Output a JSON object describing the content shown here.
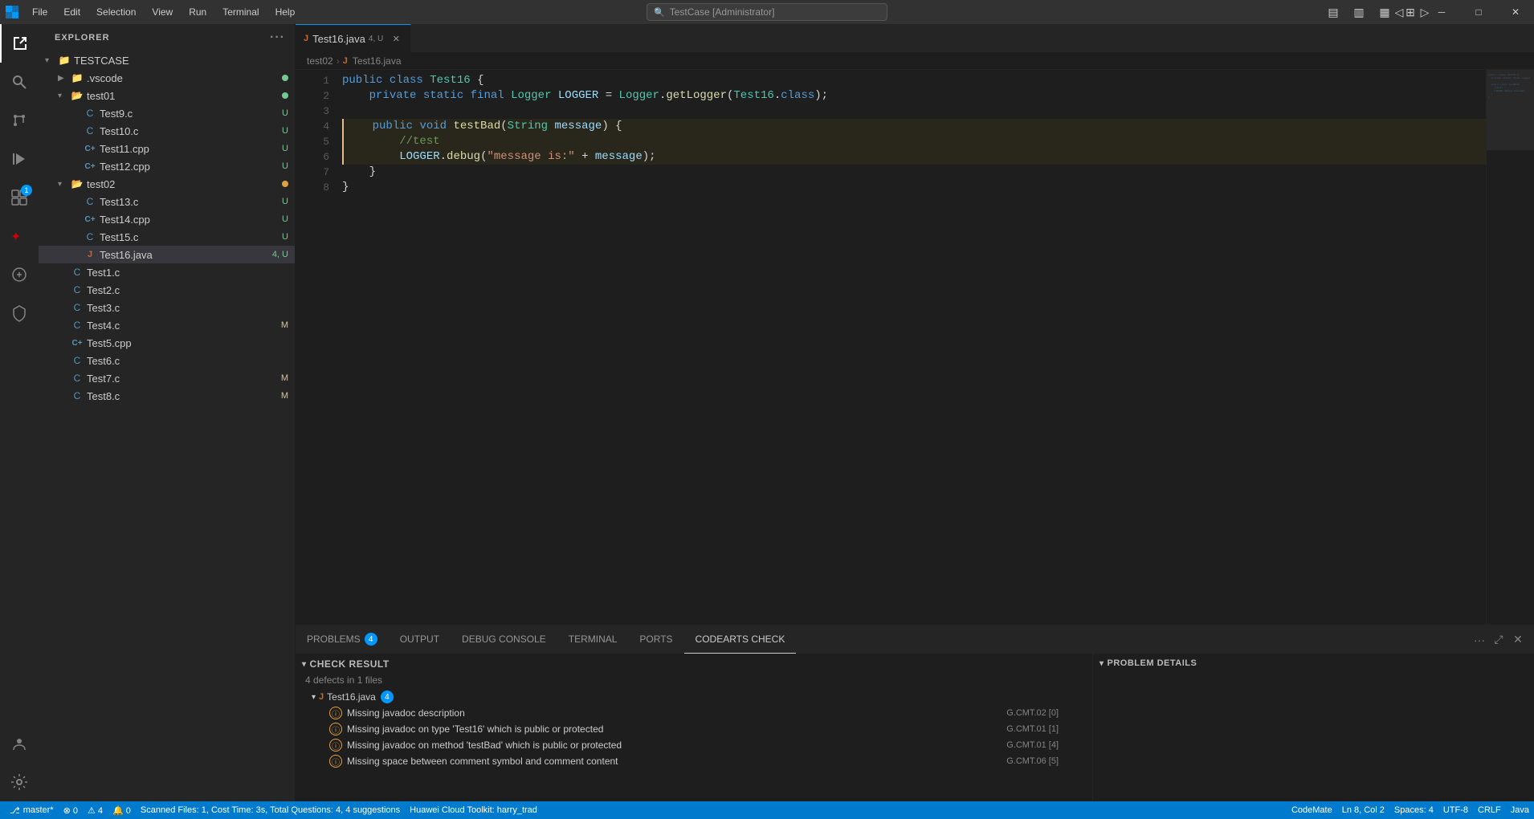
{
  "titlebar": {
    "logo": "◈",
    "menu": [
      "File",
      "Edit",
      "Selection",
      "View",
      "Run",
      "Terminal",
      "Help"
    ],
    "search_placeholder": "TestCase [Administrator]",
    "nav_back": "←",
    "nav_forward": "→",
    "btn_minimize": "─",
    "btn_maximize": "□",
    "btn_restore": "❐",
    "btn_close": "✕"
  },
  "activity_bar": {
    "icons": [
      {
        "name": "explorer-icon",
        "symbol": "⎘",
        "active": true,
        "badge": null
      },
      {
        "name": "search-icon",
        "symbol": "🔍",
        "active": false,
        "badge": null
      },
      {
        "name": "source-control-icon",
        "symbol": "⑂",
        "active": false,
        "badge": null
      },
      {
        "name": "run-debug-icon",
        "symbol": "▶",
        "active": false,
        "badge": null
      },
      {
        "name": "extensions-icon",
        "symbol": "⊞",
        "active": false,
        "badge": "1"
      },
      {
        "name": "huawei-icon",
        "symbol": "✦",
        "active": false,
        "badge": null
      },
      {
        "name": "codearts-icon",
        "symbol": "⊕",
        "active": false,
        "badge": null
      },
      {
        "name": "security-icon",
        "symbol": "🛡",
        "active": false,
        "badge": null
      }
    ],
    "bottom_icons": [
      {
        "name": "accounts-icon",
        "symbol": "👤"
      },
      {
        "name": "settings-icon",
        "symbol": "⚙"
      }
    ]
  },
  "sidebar": {
    "title": "EXPLORER",
    "root_folder": "TESTCASE",
    "items": [
      {
        "indent": 1,
        "type": "folder",
        "name": ".vscode",
        "open": false,
        "badge": "dot-green"
      },
      {
        "indent": 1,
        "type": "folder",
        "name": "test01",
        "open": true,
        "badge": "dot-green"
      },
      {
        "indent": 2,
        "type": "c",
        "name": "Test9.c",
        "badge": "U"
      },
      {
        "indent": 2,
        "type": "c",
        "name": "Test10.c",
        "badge": "U"
      },
      {
        "indent": 2,
        "type": "cpp",
        "name": "Test11.cpp",
        "badge": "U"
      },
      {
        "indent": 2,
        "type": "cpp",
        "name": "Test12.cpp",
        "badge": "U"
      },
      {
        "indent": 1,
        "type": "folder",
        "name": "test02",
        "open": true,
        "badge": "dot-orange"
      },
      {
        "indent": 2,
        "type": "c",
        "name": "Test13.c",
        "badge": "U"
      },
      {
        "indent": 2,
        "type": "cpp",
        "name": "Test14.cpp",
        "badge": "U"
      },
      {
        "indent": 2,
        "type": "c",
        "name": "Test15.c",
        "badge": "U"
      },
      {
        "indent": 2,
        "type": "java",
        "name": "Test16.java",
        "badge": "4,U",
        "active": true
      },
      {
        "indent": 1,
        "type": "c",
        "name": "Test1.c",
        "badge": ""
      },
      {
        "indent": 1,
        "type": "c",
        "name": "Test2.c",
        "badge": ""
      },
      {
        "indent": 1,
        "type": "c",
        "name": "Test3.c",
        "badge": ""
      },
      {
        "indent": 1,
        "type": "c",
        "name": "Test4.c",
        "badge": ""
      },
      {
        "indent": 1,
        "type": "cpp",
        "name": "Test5.cpp",
        "badge": ""
      },
      {
        "indent": 1,
        "type": "c",
        "name": "Test6.c",
        "badge": ""
      },
      {
        "indent": 1,
        "type": "c",
        "name": "Test7.c",
        "badge": "M"
      },
      {
        "indent": 1,
        "type": "c",
        "name": "Test8.c",
        "badge": "M"
      }
    ]
  },
  "tabs": [
    {
      "name": "Test16.java",
      "icon": "java",
      "modified": true,
      "active": true,
      "badge": "4,U"
    }
  ],
  "breadcrumb": {
    "parts": [
      "test02",
      ">",
      "Test16.java"
    ]
  },
  "code": {
    "lines": [
      {
        "num": 1,
        "content": "public class Test16 {"
      },
      {
        "num": 2,
        "content": "    private static final Logger LOGGER = Logger.getLogger(Test16.class);"
      },
      {
        "num": 3,
        "content": ""
      },
      {
        "num": 4,
        "content": "    public void testBad(String message) {"
      },
      {
        "num": 5,
        "content": "        //test"
      },
      {
        "num": 6,
        "content": "        LOGGER.debug(\"message is:\" + message);"
      },
      {
        "num": 7,
        "content": "    }"
      },
      {
        "num": 8,
        "content": "}"
      }
    ]
  },
  "panel": {
    "tabs": [
      {
        "label": "PROBLEMS",
        "badge": "4",
        "active": false
      },
      {
        "label": "OUTPUT",
        "badge": null,
        "active": false
      },
      {
        "label": "DEBUG CONSOLE",
        "badge": null,
        "active": false
      },
      {
        "label": "TERMINAL",
        "badge": null,
        "active": false
      },
      {
        "label": "PORTS",
        "badge": null,
        "active": false
      },
      {
        "label": "CODEARTS CHECK",
        "badge": null,
        "active": true
      }
    ]
  },
  "check_result": {
    "section_label": "CHECK RESULT",
    "summary": "4 defects in 1 files",
    "file_name": "Test16.java",
    "file_badge": "4",
    "issues": [
      {
        "text": "Missing javadoc description",
        "code": "G.CMT.02 [0]"
      },
      {
        "text": "Missing javadoc on type 'Test16' which is public or protected",
        "code": "G.CMT.01 [1]"
      },
      {
        "text": "Missing javadoc on method 'testBad' which is public or protected",
        "code": "G.CMT.01 [4]"
      },
      {
        "text": "Missing space between comment symbol and comment content",
        "code": "G.CMT.06 [5]"
      }
    ],
    "problem_details_label": "PROBLEM DETAILS"
  },
  "statusbar": {
    "branch": "master*",
    "errors": "⊗ 0",
    "warnings": "⚠ 4",
    "info": "0",
    "scan_info": "Scanned Files: 1, Cost Time: 3s, Total Questions: 4,  4 suggestions",
    "toolkit": "Huawei Cloud Toolkit: harry_trad",
    "codemate": "CodeMate",
    "position": "Ln 8, Col 2",
    "spaces": "Spaces: 4",
    "encoding": "UTF-8",
    "line_ending": "CRLF",
    "language": "Java"
  }
}
